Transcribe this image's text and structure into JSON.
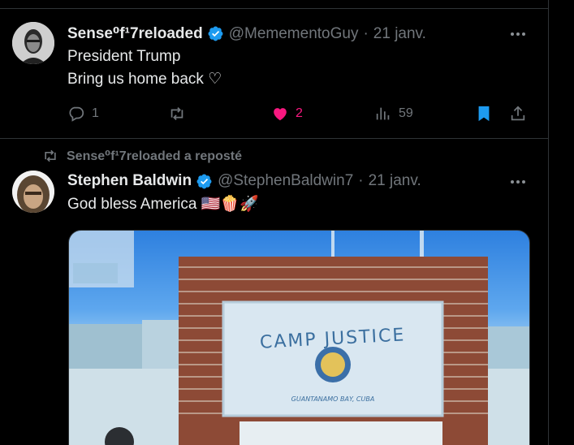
{
  "tweets": [
    {
      "author_name": "Sense⁰f¹7reloaded",
      "handle": "@MemementoGuy",
      "separator": "·",
      "date": "21 janv.",
      "text_lines": [
        "President Trump",
        "Bring us home back ♡"
      ],
      "replies": "1",
      "reposts": "",
      "likes": "2",
      "views": "59",
      "liked": true,
      "bookmarked": true
    },
    {
      "repost_label": "Sense⁰f¹7reloaded a reposté",
      "author_name": "Stephen Baldwin",
      "handle": "@StephenBaldwin7",
      "separator": "·",
      "date": "21 janv.",
      "text": "God bless America 🇺🇸🍿🚀",
      "media_sign_line1": "CAMP JUSTICE",
      "media_sign_line2": "GUANTANAMO BAY, CUBA"
    }
  ],
  "icons": {
    "verified": "verified-badge-icon",
    "more": "more-icon",
    "reply": "reply-icon",
    "repost": "repost-icon",
    "like": "heart-icon",
    "views": "views-icon",
    "bookmark": "bookmark-icon",
    "share": "share-icon"
  },
  "colors": {
    "background": "#000000",
    "verified": "#1d9bf0",
    "like": "#f91880",
    "muted": "#71767b",
    "text": "#e7e9ea"
  }
}
